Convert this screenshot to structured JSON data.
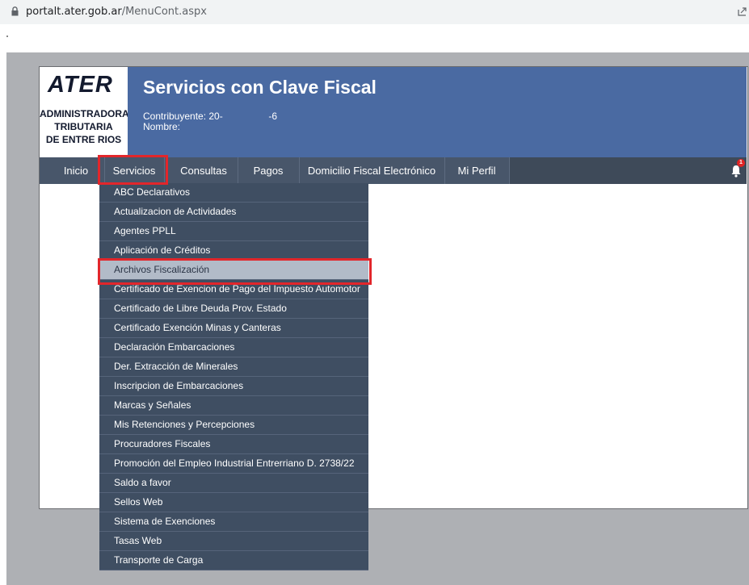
{
  "browser": {
    "url_host": "portalt.ater.gob.ar",
    "url_path": "/MenuCont.aspx"
  },
  "logo": {
    "brand": "ATER",
    "agency_lines": [
      "ADMINISTRADORA",
      "TRIBUTARIA",
      "DE ENTRE RIOS"
    ]
  },
  "header": {
    "title": "Servicios con Clave Fiscal",
    "contribuyente_label": "Contribuyente: 20-",
    "contribuyente_suffix": "-6",
    "nombre_label": "Nombre:"
  },
  "nav": {
    "items": [
      "Inicio",
      "Servicios",
      "Consultas",
      "Pagos",
      "Domicilio Fiscal Electrónico",
      "Mi Perfil"
    ],
    "active": "Servicios",
    "notification_count": "1"
  },
  "dropdown": {
    "highlighted": "Archivos Fiscalización",
    "items": [
      "ABC Declarativos",
      "Actualizacion de Actividades",
      "Agentes PPLL",
      "Aplicación de Créditos",
      "Archivos Fiscalización",
      "Certificado de Exencion de Pago del Impuesto Automotor",
      "Certificado de Libre Deuda Prov. Estado",
      "Certificado Exención Minas y Canteras",
      "Declaración Embarcaciones",
      "Der. Extracción de Minerales",
      "Inscripcion de Embarcaciones",
      "Marcas y Señales",
      "Mis Retenciones y Percepciones",
      "Procuradores Fiscales",
      "Promoción del Empleo Industrial Entrerriano D. 2738/22",
      "Saldo a favor",
      "Sellos Web",
      "Sistema de Exenciones",
      "Tasas Web",
      "Transporte de Carga"
    ]
  },
  "colors": {
    "header_blue": "#4a6aa2",
    "nav_dark": "#48566a",
    "dropdown_bg": "#3f4e62",
    "highlight_bg": "#b2bbc8",
    "annotation_red": "#e2262b"
  }
}
